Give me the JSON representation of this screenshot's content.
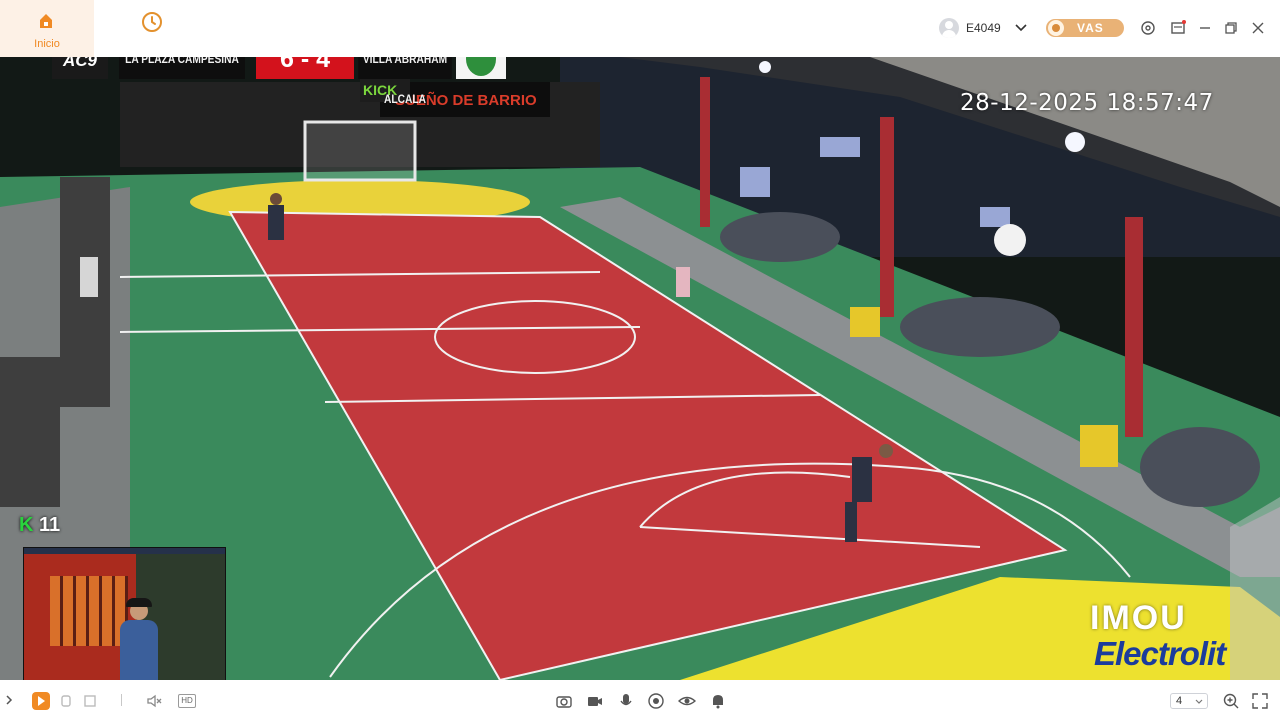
{
  "app": {
    "nav": {
      "home_label": "Inicio",
      "home_icon": "home-icon",
      "history_icon": "clock-icon"
    },
    "account": {
      "username": "E4049",
      "vas_label": "VAS"
    },
    "window_controls": [
      "settings-icon",
      "message-icon",
      "minimize-icon",
      "restore-icon",
      "close-icon"
    ],
    "accent_color": "#f08a24"
  },
  "video": {
    "timestamp": "28-12-2025 18:57:47",
    "scoreboard": {
      "logo": "AC9",
      "home_team": "LA PLAZA CAMPESINA",
      "score": "6 - 4",
      "away_team": "VILLA ABRAHAM ALCALA"
    },
    "k_badge": {
      "letter": "K",
      "number": "11"
    },
    "brand": {
      "imou": "IMOU",
      "sponsor": "Electrolit"
    },
    "sign_text": {
      "kick": "KICK",
      "sueno": "SUEÑO DE BARRIO"
    }
  },
  "toolbar": {
    "quality_label": "HD",
    "split_value": "4",
    "left_icons": [
      "play-icon",
      "stop-icon",
      "record-file-icon",
      "volume-mute-icon"
    ],
    "center_icons": [
      "snapshot-icon",
      "record-icon",
      "talk-icon",
      "ptz-icon",
      "view-icon",
      "alarm-icon"
    ],
    "right_icons": [
      "zoom-in-icon",
      "fullscreen-icon"
    ]
  }
}
